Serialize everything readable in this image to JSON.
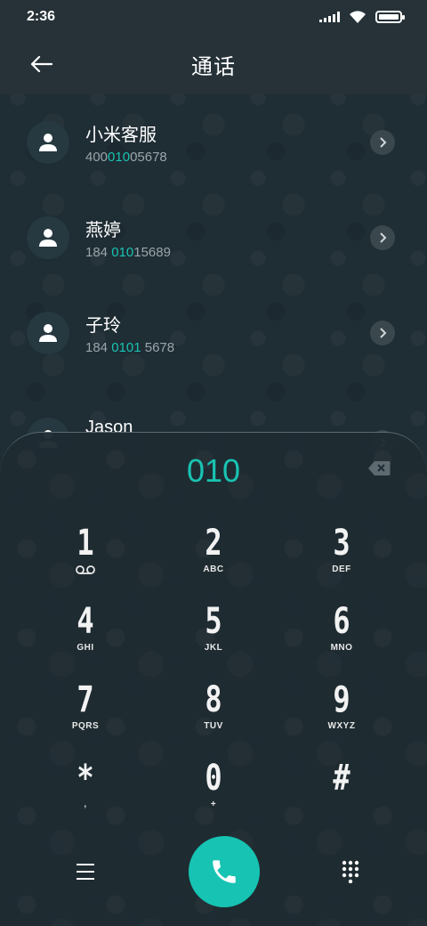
{
  "status": {
    "time": "2:36"
  },
  "header": {
    "title": "通话"
  },
  "contacts": [
    {
      "name": "小米客服",
      "number_pre": "400",
      "number_hl": "010",
      "number_post": "05678"
    },
    {
      "name": "燕婷",
      "number_pre": "184 ",
      "number_hl": "010",
      "number_post": "15689"
    },
    {
      "name": "子玲",
      "number_pre": "184 ",
      "number_hl": "0101",
      "number_post": " 5678"
    },
    {
      "name": "Jason",
      "number_pre": "",
      "number_hl": "",
      "number_post": ""
    }
  ],
  "dialer": {
    "input": "010",
    "keys": [
      {
        "digit": "1",
        "letters": "voicemail"
      },
      {
        "digit": "2",
        "letters": "ABC"
      },
      {
        "digit": "3",
        "letters": "DEF"
      },
      {
        "digit": "4",
        "letters": "GHI"
      },
      {
        "digit": "5",
        "letters": "JKL"
      },
      {
        "digit": "6",
        "letters": "MNO"
      },
      {
        "digit": "7",
        "letters": "PQRS"
      },
      {
        "digit": "8",
        "letters": "TUV"
      },
      {
        "digit": "9",
        "letters": "WXYZ"
      },
      {
        "digit": "*",
        "letters": ","
      },
      {
        "digit": "0",
        "letters": "+"
      },
      {
        "digit": "#",
        "letters": ""
      }
    ]
  },
  "colors": {
    "accent": "#19c3b2",
    "background": "#1f2d34",
    "header": "#263238"
  },
  "icons": [
    "back-arrow-icon",
    "person-icon",
    "chevron-right-icon",
    "backspace-icon",
    "voicemail-icon",
    "menu-icon",
    "phone-icon",
    "dialpad-icon",
    "signal-icon",
    "wifi-icon",
    "battery-icon"
  ]
}
